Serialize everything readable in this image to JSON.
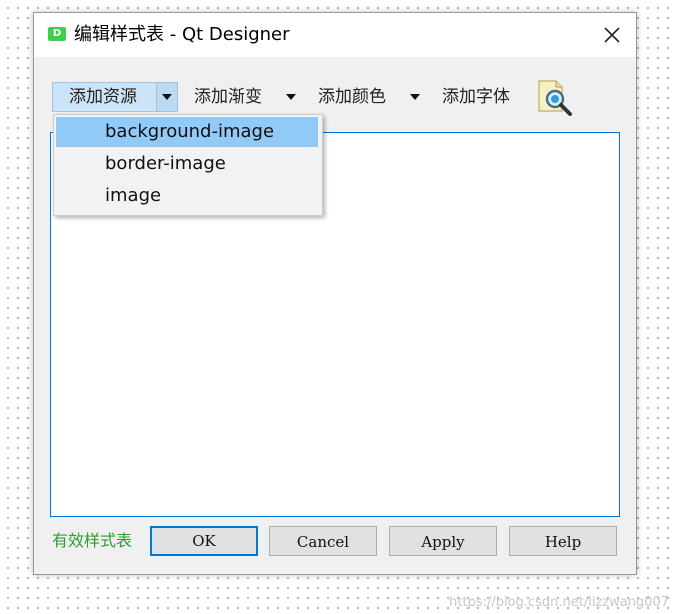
{
  "window": {
    "title": "编辑样式表 - Qt Designer",
    "app_icon_letter": "D"
  },
  "toolbar": {
    "add_resource": "添加资源",
    "add_gradient": "添加渐变",
    "add_color": "添加颜色",
    "add_font": "添加字体"
  },
  "dropdown": {
    "items": [
      {
        "label": "background-image",
        "highlighted": true
      },
      {
        "label": "border-image",
        "highlighted": false
      },
      {
        "label": "image",
        "highlighted": false
      }
    ]
  },
  "editor": {
    "content": ""
  },
  "status": {
    "label": "有效样式表",
    "color": "#2e9e2e"
  },
  "buttons": {
    "ok": "OK",
    "cancel": "Cancel",
    "apply": "Apply",
    "help": "Help"
  },
  "watermark": "https://blog.csdn.net/lizzwang007",
  "colors": {
    "accent": "#0078d7",
    "highlight": "#91c9f7",
    "qt_green": "#41cd52"
  },
  "icons": {
    "close": "close-icon",
    "preview": "magnifier-icon",
    "app": "qt-designer-icon"
  }
}
